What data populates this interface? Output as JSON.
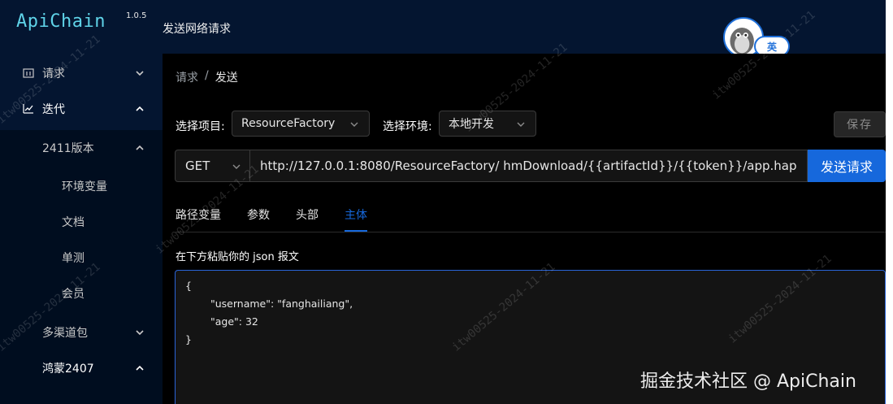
{
  "app": {
    "logo": "ApiChain",
    "version": "1.0.5",
    "header_title": "发送网络请求",
    "lang_toggle": "英"
  },
  "sidebar": {
    "items": [
      {
        "label": "请求",
        "icon": "window-icon",
        "expanded": false
      },
      {
        "label": "迭代",
        "icon": "line-chart-icon",
        "expanded": true
      },
      {
        "label": "2411版本",
        "expanded": true
      },
      {
        "label": "环境变量"
      },
      {
        "label": "文档"
      },
      {
        "label": "单测"
      },
      {
        "label": "会员"
      },
      {
        "label": "多渠道包",
        "expanded": false
      },
      {
        "label": "鸿蒙2407",
        "expanded": true
      }
    ]
  },
  "breadcrumb": {
    "root": "请求",
    "separator": "/",
    "current": "发送"
  },
  "toolbar": {
    "project_label": "选择项目:",
    "project_value": "ResourceFactory",
    "env_label": "选择环境:",
    "env_value": "本地开发",
    "save_label": "保存"
  },
  "request": {
    "method": "GET",
    "url": "http://127.0.0.1:8080/ResourceFactory/ hmDownload/{{artifactId}}/{{token}}/app.hap",
    "send_label": "发送请求"
  },
  "tabs": [
    {
      "label": "路径变量",
      "active": false
    },
    {
      "label": "参数",
      "active": false
    },
    {
      "label": "头部",
      "active": false
    },
    {
      "label": "主体",
      "active": true
    }
  ],
  "body": {
    "hint": "在下方粘贴你的 json 报文",
    "lines": [
      "{",
      "\"username\": \"fanghailiang\",",
      "\"age\": 32",
      "}"
    ]
  },
  "watermark": {
    "brand": "掘金技术社区 @ ApiChain",
    "stamp": "itw00525-2024-11-21"
  },
  "colors": {
    "sidebar_bg": "#041530",
    "accent": "#1668dc",
    "logo": "#5fd3e8"
  }
}
